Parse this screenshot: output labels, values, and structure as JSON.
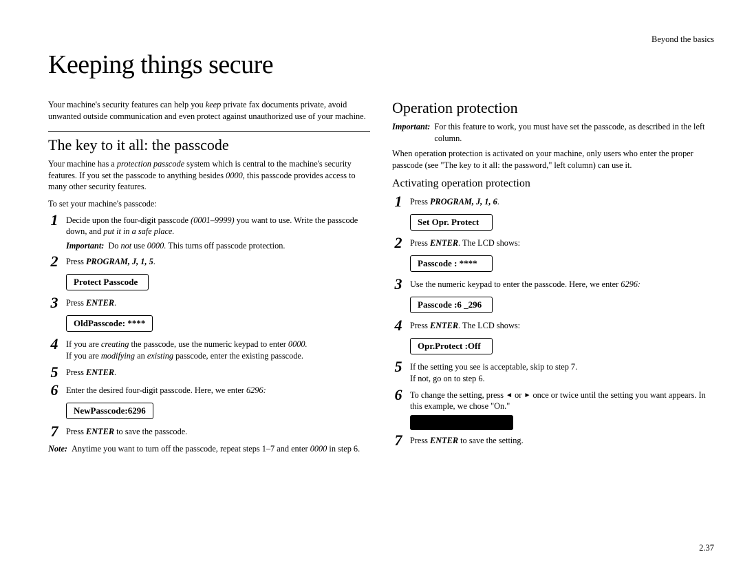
{
  "header": {
    "right": "Beyond the basics"
  },
  "title": "Keeping things secure",
  "left": {
    "intro": {
      "pre": "Your machine's security features can help you ",
      "keep": "keep",
      "post": " private fax documents private, avoid unwanted outside communication and even protect against unauthorized use of your machine."
    },
    "section1": {
      "heading": "The key to it all: the passcode",
      "p1a": "Your machine has a ",
      "p1b": "protection passcode",
      "p1c": " system which is central to the machine's security features. If you set the passcode to anything besides ",
      "p1d": "0000",
      "p1e": ", this passcode provides access to many other security features.",
      "lead": "To set your machine's passcode:",
      "step1a": "Decide upon the four-digit passcode ",
      "step1b": "(0001–9999)",
      "step1c": " you want to use. Write the passcode down, and ",
      "step1d": "put it in a safe place.",
      "important_label": "Important:",
      "important_a": "Do ",
      "important_b": "not",
      "important_c": " use ",
      "important_d": "0000.",
      "important_e": " This turns off passcode protection.",
      "step2a": "Press ",
      "step2b": "PROGRAM",
      "step2c": ", J, 1, 5",
      "step2d": ".",
      "lcd1": "Protect Passcode",
      "step3a": "Press ",
      "step3b": "ENTER",
      "step3c": ".",
      "lcd2": "OldPasscode: ****",
      "step4a": "If you are ",
      "step4b": "creating",
      "step4c": " the passcode, use the numeric keypad to enter ",
      "step4d": "0000.",
      "step4e": "If you are ",
      "step4f": "modifying",
      "step4g": " an ",
      "step4h": "existing",
      "step4i": " passcode, enter the existing passcode.",
      "step5a": "Press ",
      "step5b": "ENTER",
      "step5c": ".",
      "step6a": "Enter the desired four-digit passcode. Here, we enter ",
      "step6b": "6296:",
      "lcd3": "NewPasscode:6296",
      "step7a": "Press ",
      "step7b": "ENTER",
      "step7c": " to save the passcode.",
      "note_label": "Note:",
      "note_a": "Anytime you want to turn off the passcode, repeat steps 1–7 and enter ",
      "note_b": "0000",
      "note_c": " in step 6."
    }
  },
  "right": {
    "heading": "Operation protection",
    "important_label": "Important:",
    "important_text": "For this feature to work, you must have set the passcode, as described in the left column.",
    "p1": "When operation protection is activated on your machine, only users who enter the proper passcode (see \"The key to it all: the password,\" left column) can use it.",
    "sub": "Activating operation protection",
    "step1a": "Press ",
    "step1b": "PROGRAM",
    "step1c": ", J, 1, 6",
    "step1d": ".",
    "lcd1": "Set Opr. Protect",
    "step2a": "Press ",
    "step2b": "ENTER",
    "step2c": ". The ",
    "step2d": "LCD",
    "step2e": " shows:",
    "lcd2": "Passcode   :   ****",
    "step3a": "Use the numeric keypad to enter the passcode. Here, we enter ",
    "step3b": "6296:",
    "lcd3": "Passcode   :6 _296",
    "step4a": "Press ",
    "step4b": "ENTER",
    "step4c": ". The ",
    "step4d": "LCD",
    "step4e": " shows:",
    "lcd4": "Opr.Protect :Off",
    "step5a": "If the setting you see is acceptable, skip to step 7.",
    "step5b": "If not, go on to step 6.",
    "step6a": "To change the setting, press ",
    "step6b": " or ",
    "step6c": " once or twice until the setting you want appears. In this example, we chose \"On.\"",
    "step7a": "Press ",
    "step7b": "ENTER",
    "step7c": " to save the setting."
  },
  "nums": {
    "n1": "1",
    "n2": "2",
    "n3": "3",
    "n4": "4",
    "n5": "5",
    "n6": "6",
    "n7": "7"
  },
  "tri": {
    "left": "◄",
    "right": "►"
  },
  "pagenum": "2.37"
}
